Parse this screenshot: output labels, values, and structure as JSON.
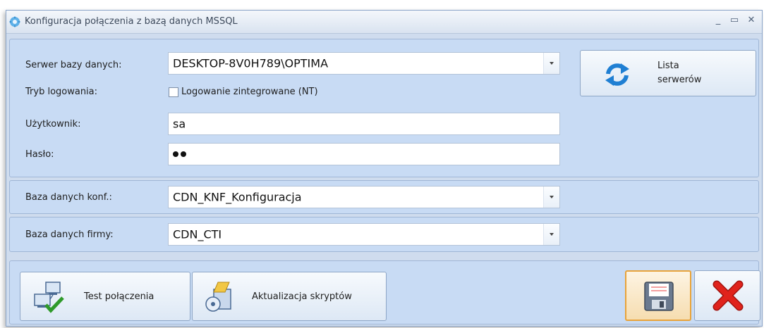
{
  "window": {
    "title": "Konfiguracja połączenia z bazą danych MSSQL"
  },
  "connection": {
    "server_label": "Serwer bazy danych:",
    "server_value": "DESKTOP-8V0H789\\OPTIMA",
    "login_mode_label": "Tryb logowania:",
    "integrated_login_label": "Logowanie zintegrowane (NT)",
    "integrated_login_checked": false,
    "user_label": "Użytkownik:",
    "user_value": "sa",
    "password_label": "Hasło:",
    "password_length": 2,
    "server_list_line1": "Lista",
    "server_list_line2": "serwerów"
  },
  "config_db": {
    "label": "Baza danych konf.:",
    "value": "CDN_KNF_Konfiguracja"
  },
  "company_db": {
    "label": "Baza danych firmy:",
    "value": "CDN_CTI"
  },
  "actions": {
    "test_connection_label": "Test połączenia",
    "update_scripts_label": "Aktualizacja skryptów"
  },
  "icons": {
    "app": "gear-icon",
    "refresh": "refresh-arrows-icon",
    "test": "network-computers-check-icon",
    "scripts": "scripts-update-icon",
    "save": "floppy-disk-icon",
    "cancel": "red-x-icon"
  },
  "colors": {
    "window_bg": "#cfdcee",
    "panel_bg": "#c8dbf4",
    "cancel_red": "#e0231c",
    "save_border": "#e8a33a"
  }
}
